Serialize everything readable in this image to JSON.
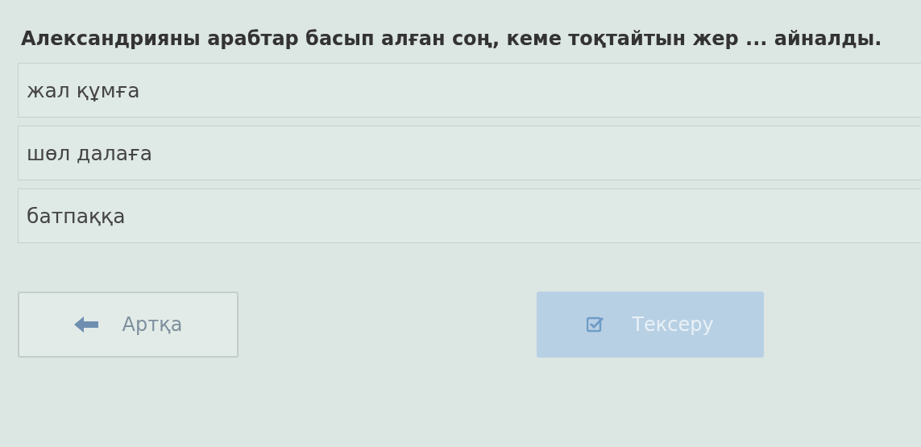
{
  "question": "Александрияны арабтар басып алған соң, кеме тоқтайтын жер ... айналды.",
  "options": [
    {
      "label": "жал құмға",
      "selected": false
    },
    {
      "label": "шөл далаға",
      "selected": false
    },
    {
      "label": "батпаққа",
      "selected": false
    }
  ],
  "back_button": {
    "label": "Артқа"
  },
  "check_button": {
    "label": "Тексеру",
    "disabled": true
  }
}
